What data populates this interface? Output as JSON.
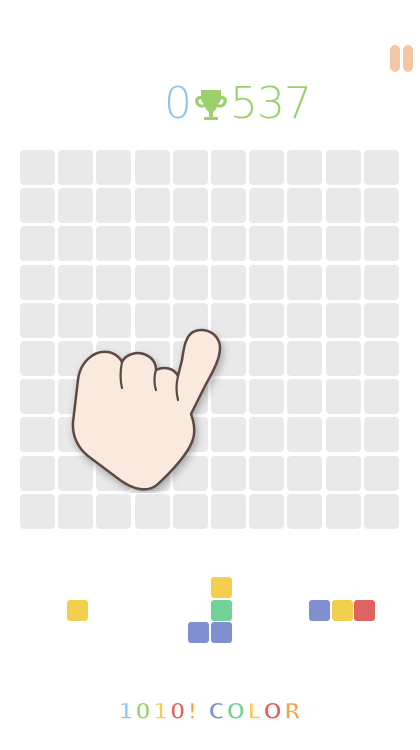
{
  "header": {
    "current_score": "0",
    "best_score": "537",
    "trophy_icon": "trophy-icon",
    "pause_icon": "pause-icon"
  },
  "colors": {
    "current_score": "#8dc6ea",
    "best_score": "#9ad16a",
    "trophy": "#9ad16a",
    "pause": "#f3c6a6",
    "empty_cell": "#e9e9e9",
    "yellow": "#f3cf50",
    "green": "#72d197",
    "blue": "#7f8fcf",
    "red": "#de6461"
  },
  "board": {
    "rows": 10,
    "cols": 10,
    "filled": []
  },
  "tray": {
    "pieces": [
      {
        "name": "piece-single-yellow",
        "blocks": [
          {
            "r": 0,
            "c": 0,
            "color": "yellow"
          }
        ]
      },
      {
        "name": "piece-l-shape",
        "blocks": [
          {
            "r": 0,
            "c": 1,
            "color": "yellow"
          },
          {
            "r": 1,
            "c": 1,
            "color": "green"
          },
          {
            "r": 2,
            "c": 0,
            "color": "blue"
          },
          {
            "r": 2,
            "c": 1,
            "color": "blue"
          }
        ]
      },
      {
        "name": "piece-horizontal-three",
        "blocks": [
          {
            "r": 0,
            "c": 0,
            "color": "blue"
          },
          {
            "r": 0,
            "c": 1,
            "color": "yellow"
          },
          {
            "r": 0,
            "c": 2,
            "color": "red"
          }
        ]
      }
    ]
  },
  "tutorial": {
    "hand_icon": "pointing-hand-icon"
  },
  "logo": {
    "text": "1010! COLOR",
    "letter_colors": [
      "#8dc6ea",
      "#9ad16a",
      "#f3cf50",
      "#de6461",
      "#f3a24a",
      "#ffffff",
      "#7f8fcf",
      "#72d197",
      "#f3cf50",
      "#de6461",
      "#f3a24a"
    ]
  }
}
